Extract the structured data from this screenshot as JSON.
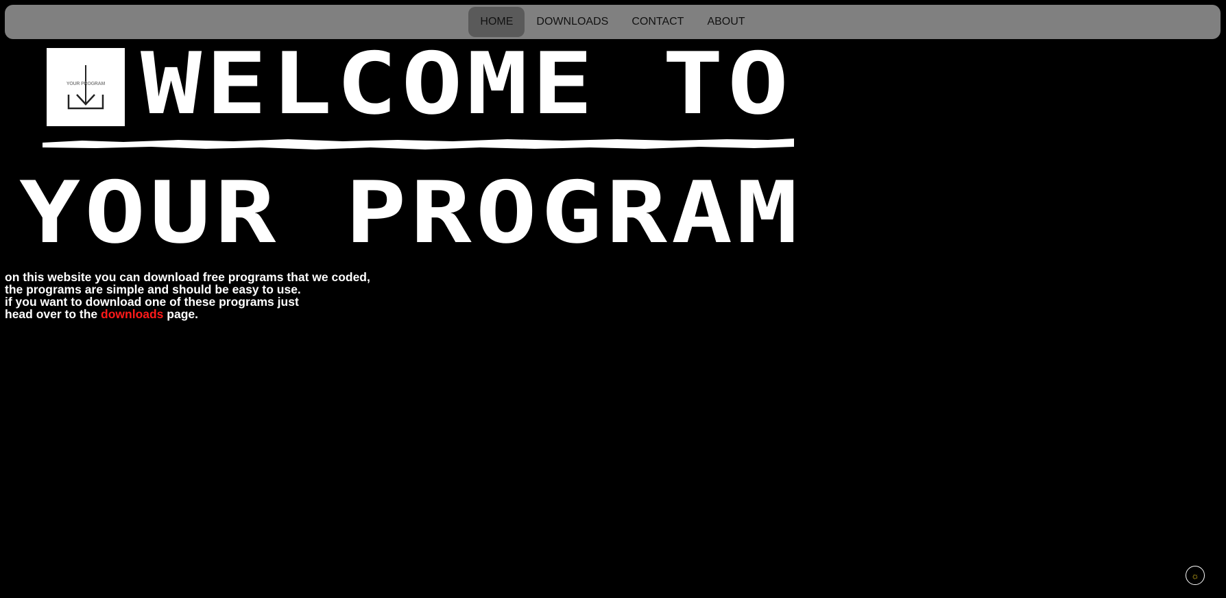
{
  "nav": {
    "items": [
      {
        "label": "HOME",
        "active": true
      },
      {
        "label": "DOWNLOADS",
        "active": false
      },
      {
        "label": "CONTACT",
        "active": false
      },
      {
        "label": "ABOUT",
        "active": false
      }
    ]
  },
  "hero": {
    "logo_text": "YOUR PROGRAM",
    "logo_icon": "download-icon",
    "headline_line1": "WELCOME TO",
    "headline_line2": "YOUR PROGRAM"
  },
  "intro": {
    "line1": "on this website you can download free programs that we coded,",
    "line2": "the programs are simple and should be easy to use.",
    "line3": "if you want to download one of these programs just",
    "line4_before": "head over to the ",
    "line4_link": "downloads",
    "line4_after": " page."
  },
  "theme_toggle": {
    "icon": "sun-icon",
    "glyph": "☼"
  },
  "colors": {
    "background": "#000000",
    "navbar": "#808080",
    "nav_active": "#5a5a5a",
    "link": "#ff1a1a",
    "text": "#ffffff"
  }
}
